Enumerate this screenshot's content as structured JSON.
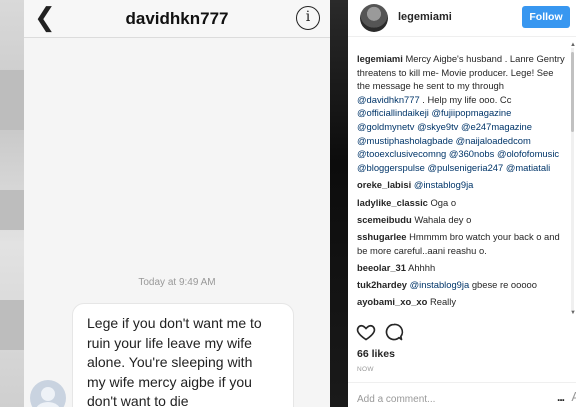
{
  "dm": {
    "back_icon": "chevron-left-icon",
    "title": "davidhkn777",
    "info_icon": "info-icon",
    "info_glyph": "i",
    "timestamp": "Today at 9:49 AM",
    "message": "Lege if you don't want me to\nruin your life leave my wife\nalone. You're sleeping with\nmy wife mercy aigbe if you\ndon't want to die"
  },
  "post": {
    "username": "legemiami",
    "follow_label": "Follow",
    "caption": {
      "user": "legemiami",
      "text": "Mercy Aigbe's husband . Lanre Gentry threatens to kill me- Movie producer. Lege! See the message he sent to my through",
      "mention": "@davidhkn777",
      "text2": ". Help my life ooo. Cc",
      "tags": "@officiallindaikeji @fujiipopmagazine @goldmynetv @skye9tv @e247magazine @mustiphasholagbade @naijaloadedcom @tooexclusivecomng @360nobs @olofofomusic @bloggerspulse @pulsenigeria247 @matiatali"
    },
    "comments": [
      {
        "user": "oreke_labisi",
        "text": "",
        "mention": "@instablog9ja"
      },
      {
        "user": "ladylike_classic",
        "text": "Oga o",
        "mention": ""
      },
      {
        "user": "scemeibudu",
        "text": "Wahala dey o",
        "mention": ""
      },
      {
        "user": "sshugarlee",
        "text": "Hmmmm bro watch your back o and be more careful..aani reashu o.",
        "mention": ""
      },
      {
        "user": "beeolar_31",
        "text": "Ahhhh",
        "mention": ""
      },
      {
        "user": "tuk2hardey",
        "text": "gbese re ooooo",
        "mention": "@instablog9ja"
      },
      {
        "user": "ayobami_xo_xo",
        "text": "Really",
        "mention": ""
      }
    ],
    "likes": "66 likes",
    "time": "NOW",
    "add_comment_placeholder": "Add a comment...",
    "more_label": "...",
    "trailing_char": "A"
  },
  "colors": {
    "follow_bg": "#3897f0",
    "mention": "#003569",
    "dm_bg": "#f5f5f5"
  }
}
